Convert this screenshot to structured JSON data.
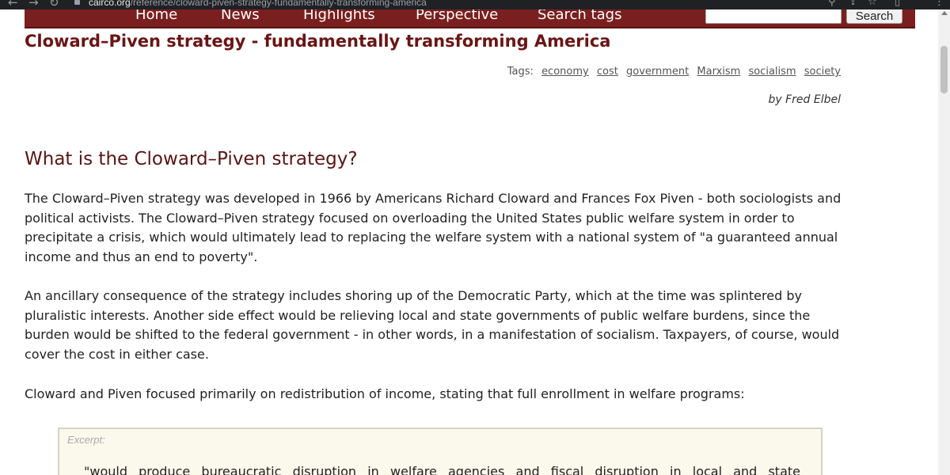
{
  "browser": {
    "url_host": "cairco.org",
    "url_path": "/reference/cloward-piven-strategy-fundamentally-transforming-america"
  },
  "navbar": {
    "items": [
      "Home",
      "News",
      "Highlights",
      "Perspective",
      "Search tags"
    ],
    "search_button": "Search",
    "search_value": ""
  },
  "article": {
    "title": "Cloward–Piven strategy - fundamentally transforming America",
    "tags_label": "Tags:",
    "tags": [
      "economy",
      "cost",
      "government",
      "Marxism",
      "socialism",
      "society"
    ],
    "byline": "by Fred Elbel",
    "heading": "What is the Cloward–Piven strategy?",
    "paragraphs": [
      "The Cloward–Piven strategy was developed in 1966 by Americans Richard Cloward and Frances Fox Piven - both sociologists and political activists. The Cloward–Piven strategy focused on overloading the United States public welfare system in order to precipitate a crisis, which would ultimately lead to replacing the welfare system with a national system of \"a guaranteed annual income and thus an end to poverty\".",
      "An ancillary consequence of the strategy includes shoring up of the Democratic Party, which at the time was splintered by pluralistic interests. Another side effect would be relieving local and state governments of public welfare burdens, since the burden would be shifted to the federal government - in other words, in a manifestation of socialism. Taxpayers, of course, would cover the cost in either case.",
      "Cloward and Piven focused primarily on redistribution of income, stating that full enrollment in welfare programs:"
    ],
    "excerpt_label": "Excerpt:",
    "excerpt_text": "\"would produce bureaucratic disruption in welfare agencies and fiscal disruption in local and state"
  },
  "colors": {
    "navbar": "#7a1f1f",
    "title": "#6b1414",
    "excerpt_bg": "#fbf8ec"
  },
  "icons": [
    "back-icon",
    "forward-icon",
    "reload-icon",
    "lock-icon",
    "zoom-icon",
    "share-icon",
    "bookmark-star-icon",
    "sidepanel-icon",
    "menu-icon"
  ]
}
